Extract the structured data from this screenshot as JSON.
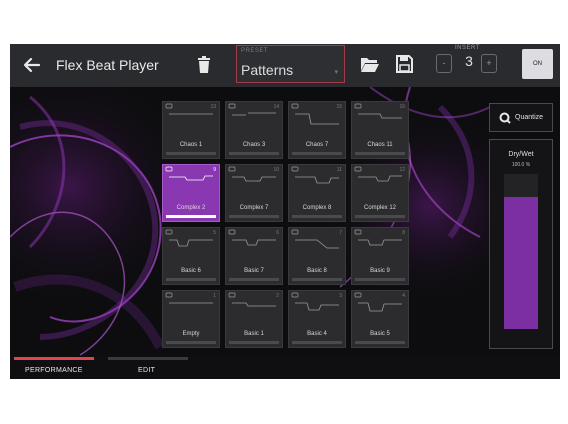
{
  "header": {
    "title": "Flex Beat Player",
    "preset_label": "PRESET",
    "preset_value": "Patterns",
    "insert_label": "INSERT",
    "insert_value": "3",
    "on_label": "ON"
  },
  "pads": [
    {
      "label": "Chaos 1",
      "num": "13",
      "selected": false
    },
    {
      "label": "Chaos 3",
      "num": "14",
      "selected": false
    },
    {
      "label": "Chaos 7",
      "num": "15",
      "selected": false
    },
    {
      "label": "Chaos 11",
      "num": "16",
      "selected": false
    },
    {
      "label": "Complex 2",
      "num": "9",
      "selected": true
    },
    {
      "label": "Complex 7",
      "num": "10",
      "selected": false
    },
    {
      "label": "Complex 8",
      "num": "11",
      "selected": false
    },
    {
      "label": "Complex 12",
      "num": "12",
      "selected": false
    },
    {
      "label": "Basic 6",
      "num": "5",
      "selected": false
    },
    {
      "label": "Basic 7",
      "num": "6",
      "selected": false
    },
    {
      "label": "Basic 8",
      "num": "7",
      "selected": false
    },
    {
      "label": "Basic 9",
      "num": "8",
      "selected": false
    },
    {
      "label": "Empty",
      "num": "1",
      "selected": false
    },
    {
      "label": "Basic 1",
      "num": "2",
      "selected": false
    },
    {
      "label": "Basic 4",
      "num": "3",
      "selected": false
    },
    {
      "label": "Basic 5",
      "num": "4",
      "selected": false
    }
  ],
  "right_panel": {
    "quantize_label": "Quantize",
    "drywet_label": "Dry/Wet",
    "drywet_value": "100.0 %",
    "drywet_level": 1.0
  },
  "tabs": {
    "performance": "PERFORMANCE",
    "edit": "EDIT"
  },
  "colors": {
    "accent_purple": "#8a38b2",
    "active_tab_red": "#e0444e",
    "preset_border": "#a43a45"
  }
}
